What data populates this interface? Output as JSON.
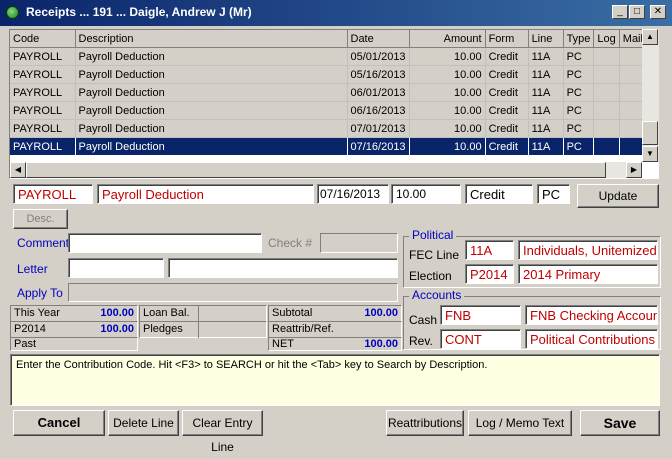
{
  "window": {
    "title": "Receipts ... 191 ... Daigle, Andrew J (Mr)",
    "controls": [
      "_",
      "□",
      "✕"
    ]
  },
  "grid": {
    "columns": [
      "Code",
      "Description",
      "Date",
      "Amount",
      "Form",
      "Line",
      "Type",
      "Log",
      "Mail"
    ],
    "rows": [
      [
        "PAYROLL",
        "Payroll Deduction",
        "05/01/2013",
        "10.00",
        "Credit",
        "11A",
        "PC",
        "",
        ""
      ],
      [
        "PAYROLL",
        "Payroll Deduction",
        "05/16/2013",
        "10.00",
        "Credit",
        "11A",
        "PC",
        "",
        ""
      ],
      [
        "PAYROLL",
        "Payroll Deduction",
        "06/01/2013",
        "10.00",
        "Credit",
        "11A",
        "PC",
        "",
        ""
      ],
      [
        "PAYROLL",
        "Payroll Deduction",
        "06/16/2013",
        "10.00",
        "Credit",
        "11A",
        "PC",
        "",
        ""
      ],
      [
        "PAYROLL",
        "Payroll Deduction",
        "07/01/2013",
        "10.00",
        "Credit",
        "11A",
        "PC",
        "",
        ""
      ],
      [
        "PAYROLL",
        "Payroll Deduction",
        "07/16/2013",
        "10.00",
        "Credit",
        "11A",
        "PC",
        "",
        ""
      ]
    ],
    "selected_row": 5
  },
  "entry": {
    "code": "PAYROLL",
    "description": "Payroll Deduction",
    "date": "07/16/2013",
    "amount": "10.00",
    "form": "Credit",
    "type": "PC",
    "update_label": "Update",
    "desc_label": "Desc."
  },
  "fields": {
    "comment_label": "Comment",
    "check_label": "Check #",
    "letter_label": "Letter",
    "apply_to_label": "Apply To"
  },
  "political": {
    "title": "Political",
    "fec_line_label": "FEC Line",
    "fec_line_code": "11A",
    "fec_line_desc": "Individuals, Unitemized",
    "election_label": "Election",
    "election_code": "P2014",
    "election_desc": "2014 Primary"
  },
  "accounts": {
    "title": "Accounts",
    "cash_label": "Cash",
    "cash_code": "FNB",
    "cash_desc": "FNB Checking Account",
    "rev_label": "Rev.",
    "rev_code": "CONT",
    "rev_desc": "Political Contributions"
  },
  "summary": {
    "this_year_label": "This Year",
    "this_year_value": "100.00",
    "p2014_label": "P2014",
    "p2014_value": "100.00",
    "past_label": "Past",
    "past_value": "",
    "loan_bal_label": "Loan Bal.",
    "loan_bal_value": "",
    "pledges_label": "Pledges",
    "pledges_value": "",
    "subtotal_label": "Subtotal",
    "subtotal_value": "100.00",
    "reattrib_label": "Reattrib/Ref.",
    "reattrib_value": "",
    "net_label": "NET",
    "net_value": "100.00"
  },
  "help_text": "Enter the Contribution Code.  Hit <F3> to SEARCH or hit the <Tab> key to Search by Description.",
  "buttons": {
    "cancel": "Cancel",
    "delete_line": "Delete Line",
    "clear_entry_line": "Clear Entry Line",
    "reattributions": "Reattributions",
    "log_memo": "Log / Memo Text",
    "save": "Save"
  },
  "colors": {
    "title_bar": "#0a246a",
    "selection": "#0a246a",
    "error_text": "#c00000",
    "label_blue": "#0000c0",
    "help_bg": "#ffffe1"
  }
}
